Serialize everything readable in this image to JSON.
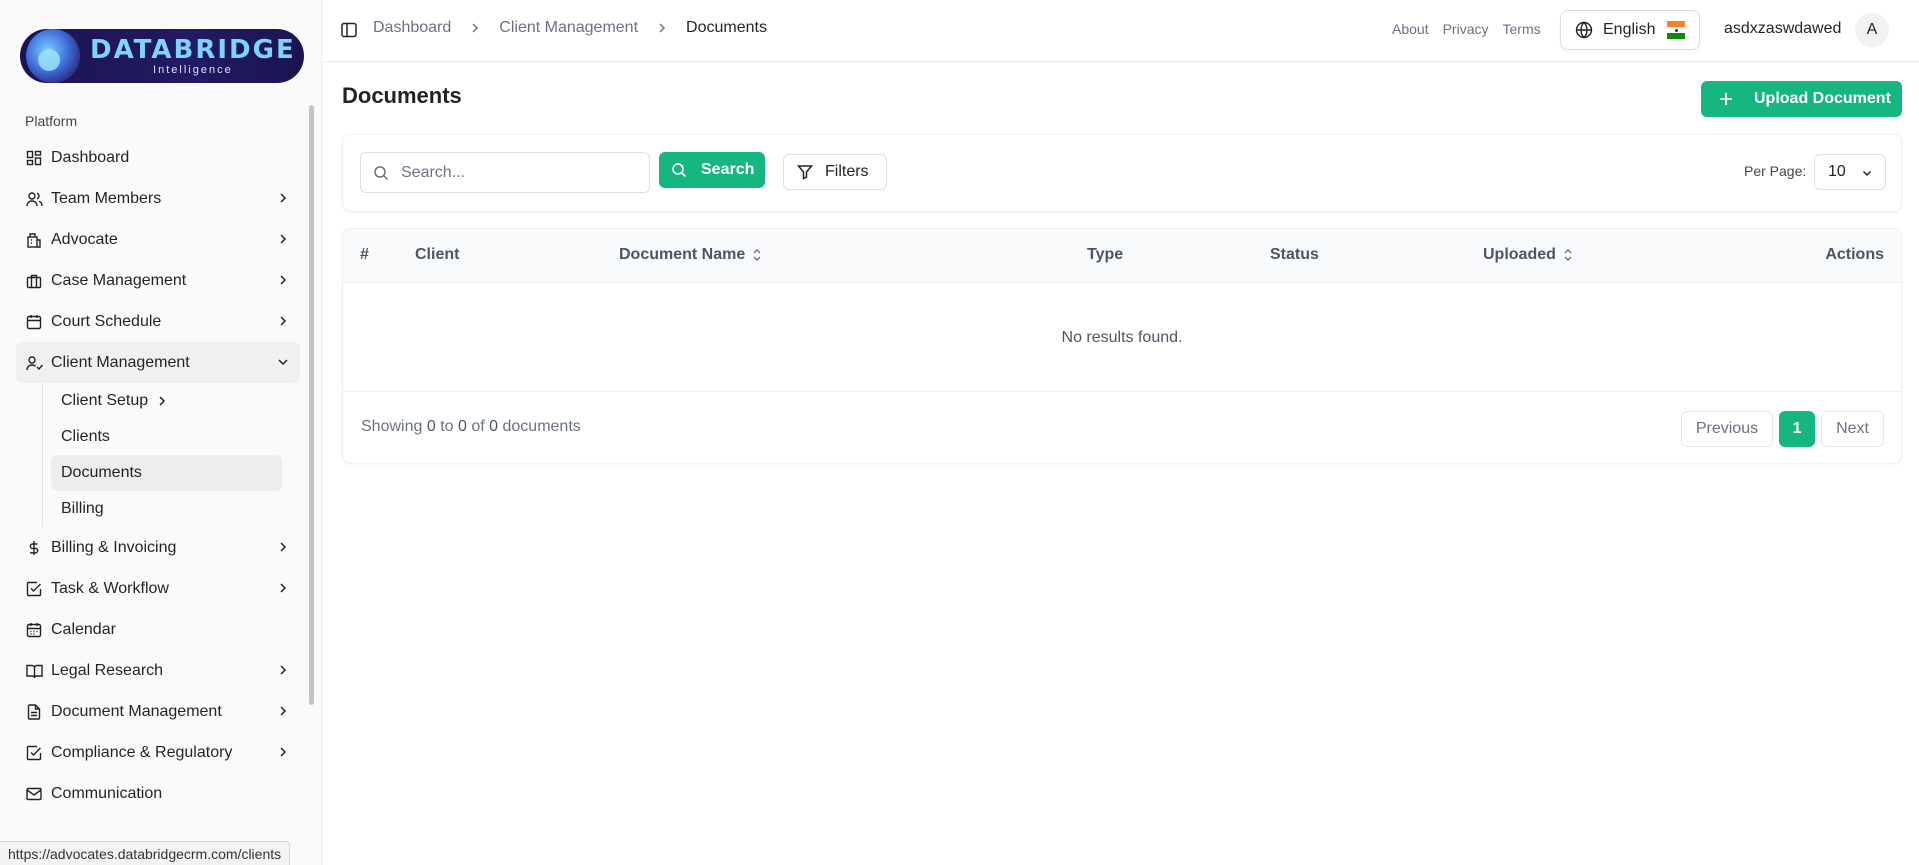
{
  "brand": {
    "name": "DATABRIDGE",
    "tagline": "Intelligence"
  },
  "sidebar": {
    "section_label": "Platform",
    "items": [
      {
        "label": "Dashboard",
        "icon": "dashboard-icon"
      },
      {
        "label": "Team Members",
        "icon": "users-icon"
      },
      {
        "label": "Advocate",
        "icon": "building-icon"
      },
      {
        "label": "Case Management",
        "icon": "briefcase-icon"
      },
      {
        "label": "Court Schedule",
        "icon": "calendar-icon"
      },
      {
        "label": "Client Management",
        "icon": "user-check-icon"
      },
      {
        "label": "Billing & Invoicing",
        "icon": "dollar-icon"
      },
      {
        "label": "Task & Workflow",
        "icon": "check-square-icon"
      },
      {
        "label": "Calendar",
        "icon": "calendar-icon"
      },
      {
        "label": "Legal Research",
        "icon": "book-icon"
      },
      {
        "label": "Document Management",
        "icon": "file-icon"
      },
      {
        "label": "Compliance & Regulatory",
        "icon": "check-square-icon"
      },
      {
        "label": "Communication",
        "icon": "mail-icon"
      }
    ],
    "client_submenu": [
      {
        "label": "Client Setup"
      },
      {
        "label": "Clients"
      },
      {
        "label": "Documents"
      },
      {
        "label": "Billing"
      }
    ]
  },
  "statusbar": {
    "url": "https://advocates.databridgecrm.com/clients"
  },
  "header": {
    "breadcrumbs": [
      "Dashboard",
      "Client Management",
      "Documents"
    ],
    "links": [
      "About",
      "Privacy",
      "Terms"
    ],
    "language": "English",
    "username": "asdxzaswdawed",
    "avatar_initial": "A"
  },
  "page": {
    "title": "Documents",
    "upload_label": "Upload Document",
    "search_placeholder": "Search...",
    "search_value": "",
    "search_label": "Search",
    "filters_label": "Filters",
    "per_page_label": "Per Page:",
    "per_page_value": "10"
  },
  "table": {
    "columns": [
      "#",
      "Client",
      "Document Name",
      "Type",
      "Status",
      "Uploaded",
      "Actions"
    ],
    "empty_text": "No results found.",
    "showing_prefix": "Showing",
    "showing_from": "0",
    "showing_to_word": "to",
    "showing_to": "0",
    "showing_of_word": "of",
    "showing_total": "0",
    "showing_suffix": "documents"
  },
  "pagination": {
    "previous": "Previous",
    "current": "1",
    "next": "Next"
  },
  "colors": {
    "accent": "#15b681",
    "brand_bg": "#1a1550",
    "flag_saffron": "#f4822b",
    "flag_green": "#138808"
  }
}
